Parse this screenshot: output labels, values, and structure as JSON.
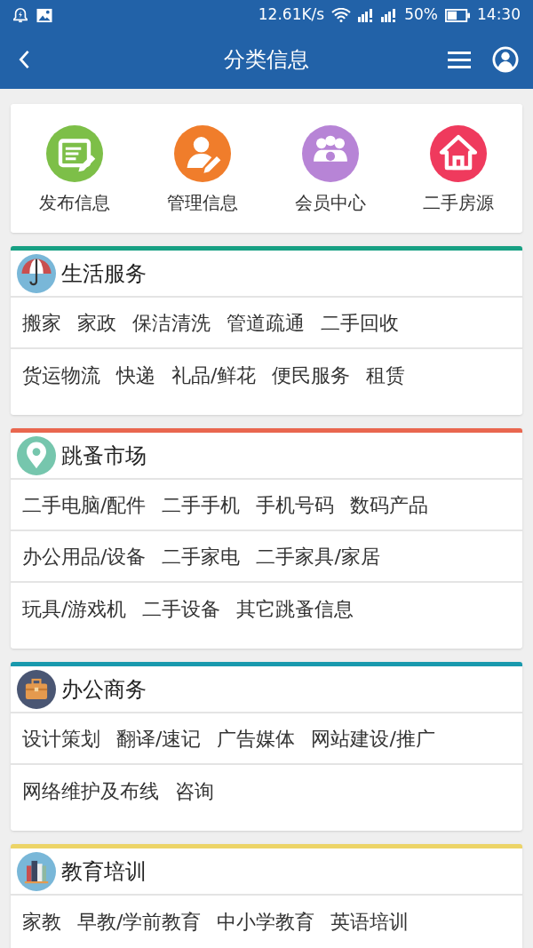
{
  "status_bar": {
    "speed": "12.61K/s",
    "battery": "50%",
    "time": "14:30"
  },
  "header": {
    "title": "分类信息"
  },
  "quick_links": [
    {
      "label": "发布信息",
      "kind": "post",
      "color": "#7dbf48"
    },
    {
      "label": "管理信息",
      "kind": "manage",
      "color": "#f07d2b"
    },
    {
      "label": "会员中心",
      "kind": "members",
      "color": "#b784d6"
    },
    {
      "label": "二手房源",
      "kind": "house",
      "color": "#ef3a5d"
    }
  ],
  "sections": [
    {
      "title": "生活服务",
      "kind": "umbrella",
      "color": "#17a083",
      "rows": [
        [
          "搬家",
          "家政",
          "保洁清洗",
          "管道疏通",
          "二手回收"
        ],
        [
          "货运物流",
          "快递",
          "礼品/鲜花",
          "便民服务",
          "租赁"
        ]
      ]
    },
    {
      "title": "跳蚤市场",
      "kind": "pin",
      "color": "#e9674f",
      "rows": [
        [
          "二手电脑/配件",
          "二手手机",
          "手机号码",
          "数码产品"
        ],
        [
          "办公用品/设备",
          "二手家电",
          "二手家具/家居"
        ],
        [
          "玩具/游戏机",
          "二手设备",
          "其它跳蚤信息"
        ]
      ]
    },
    {
      "title": "办公商务",
      "kind": "briefcase",
      "color": "#1899ad",
      "rows": [
        [
          "设计策划",
          "翻译/速记",
          "广告媒体",
          "网站建设/推广"
        ],
        [
          "网络维护及布线",
          "咨询"
        ]
      ]
    },
    {
      "title": "教育培训",
      "kind": "books",
      "color": "#ecd467",
      "rows": [
        [
          "家教",
          "早教/学前教育",
          "中小学教育",
          "英语培训"
        ]
      ]
    }
  ]
}
